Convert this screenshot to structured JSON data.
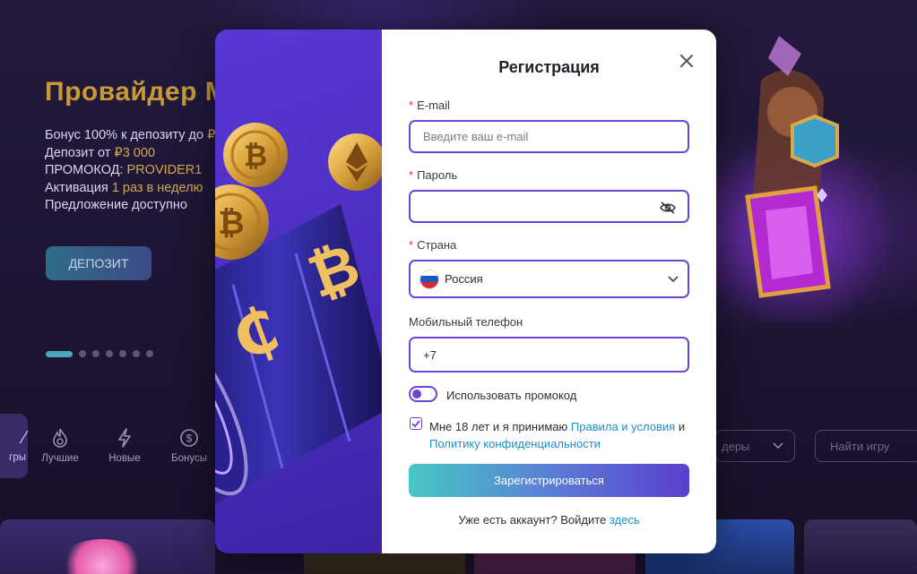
{
  "background": {
    "promo": {
      "title": "Провайдер M",
      "line1": "Бонус 100% к депозиту до ",
      "line1_amount": "₽",
      "line2_prefix": "Депозит от ",
      "line2_amount": "₽3 000",
      "line3_prefix": "ПРОМОКОД: ",
      "line3_code": "PROVIDER1",
      "line4_prefix": "Активация ",
      "line4_value": "1 раз в неделю",
      "line5": "Предложение доступно",
      "deposit_button": "ДЕПОЗИТ"
    },
    "categories": [
      {
        "label": "гры",
        "icon": "games-icon"
      },
      {
        "label": "Лучшие",
        "icon": "flame-icon"
      },
      {
        "label": "Новые",
        "icon": "lightning-icon"
      },
      {
        "label": "Бонусы",
        "icon": "dollar-icon"
      }
    ],
    "provider_select": "деры",
    "game_search_placeholder": "Найти игру"
  },
  "modal": {
    "title": "Регистрация",
    "email": {
      "label": "E-mail",
      "required_mark": "*",
      "placeholder": "Введите ваш e-mail",
      "value": ""
    },
    "password": {
      "label": "Пароль",
      "required_mark": "*",
      "value": ""
    },
    "country": {
      "label": "Страна",
      "required_mark": "*",
      "value": "Россия"
    },
    "phone": {
      "label": "Мобильный телефон",
      "value": "+7"
    },
    "promo_toggle": {
      "label": "Использовать промокод",
      "on": false
    },
    "terms": {
      "checked": true,
      "text1": "Мне 18 лет и я принимаю ",
      "link1": "Правила и условия",
      "text2": " и ",
      "link2": "Политику конфиденциальности"
    },
    "submit_label": "Зарегистрироваться",
    "login_prompt": "Уже есть аккаунт? Войдите ",
    "login_link": "здесь"
  },
  "colors": {
    "accent": "#6a45d6",
    "link": "#1d8fc8",
    "gold": "#c69a35",
    "required": "#e0344b"
  }
}
